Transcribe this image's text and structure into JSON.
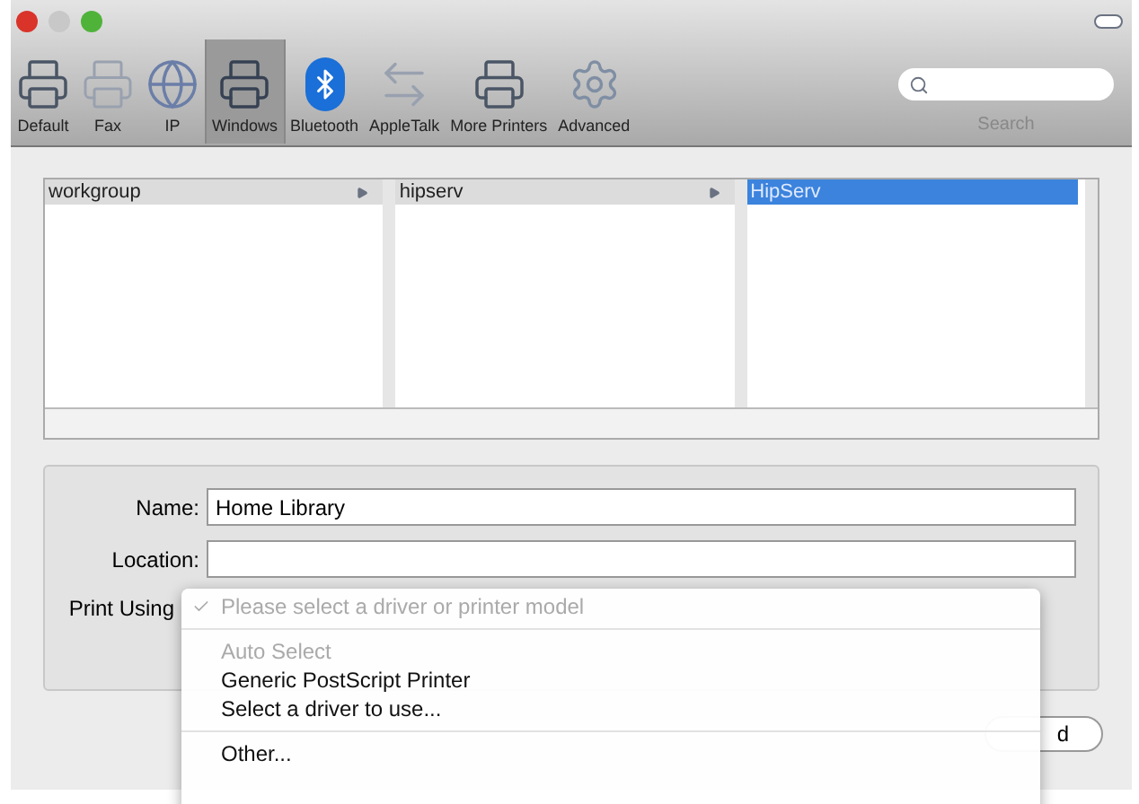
{
  "toolbar": {
    "items": [
      {
        "label": "Default",
        "selected": false
      },
      {
        "label": "Fax",
        "selected": false
      },
      {
        "label": "IP",
        "selected": false
      },
      {
        "label": "Windows",
        "selected": true
      },
      {
        "label": "Bluetooth",
        "selected": false
      },
      {
        "label": "AppleTalk",
        "selected": false
      },
      {
        "label": "More Printers",
        "selected": false
      },
      {
        "label": "Advanced",
        "selected": false
      }
    ],
    "search": {
      "label": "Search"
    }
  },
  "browser": {
    "columns": [
      {
        "items": [
          {
            "label": "workgroup",
            "selected": false,
            "has_children": true
          }
        ]
      },
      {
        "items": [
          {
            "label": "hipserv",
            "selected": false,
            "has_children": true
          }
        ]
      },
      {
        "items": [
          {
            "label": "HipServ",
            "selected": true,
            "has_children": false
          }
        ]
      }
    ]
  },
  "form": {
    "name": {
      "label": "Name:",
      "value": "Home Library"
    },
    "location": {
      "label": "Location:"
    },
    "print_using": {
      "label": "Print Using"
    }
  },
  "menu": [
    {
      "kind": "item",
      "label": "Please select a driver or printer model",
      "checked": true,
      "disabled": true
    },
    {
      "kind": "separator"
    },
    {
      "kind": "item",
      "label": "Auto Select",
      "checked": false,
      "disabled": true
    },
    {
      "kind": "item",
      "label": "Generic PostScript Printer",
      "checked": false,
      "disabled": false
    },
    {
      "kind": "item",
      "label": "Select a driver to use...",
      "checked": false,
      "disabled": false
    },
    {
      "kind": "separator"
    },
    {
      "kind": "item",
      "label": "Other...",
      "checked": false,
      "disabled": false
    }
  ],
  "add_button": {
    "label": "d"
  }
}
